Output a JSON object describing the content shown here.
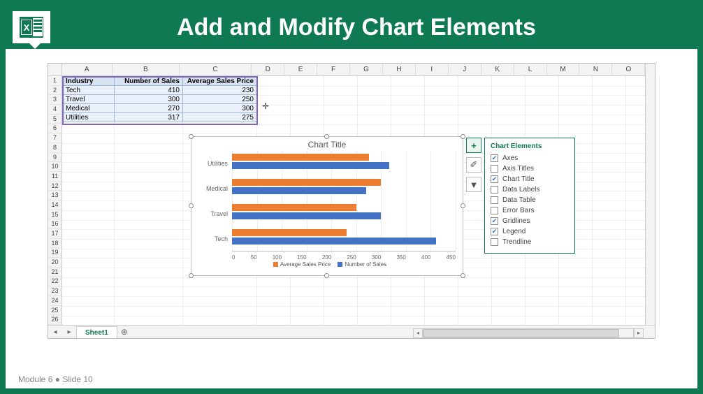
{
  "header": {
    "title": "Add and Modify Chart Elements",
    "app_icon_letter": "X"
  },
  "footer": {
    "module": "Module 6",
    "bullet": "●",
    "slide": "Slide 10"
  },
  "columns": [
    "A",
    "B",
    "C",
    "D",
    "E",
    "F",
    "G",
    "H",
    "I",
    "J",
    "K",
    "L",
    "M",
    "N",
    "O"
  ],
  "row_count": 26,
  "table": {
    "headers": [
      "Industry",
      "Number of Sales",
      "Average Sales Price"
    ],
    "rows": [
      {
        "industry": "Tech",
        "sales": "410",
        "price": "230"
      },
      {
        "industry": "Travel",
        "sales": "300",
        "price": "250"
      },
      {
        "industry": "Medical",
        "sales": "270",
        "price": "300"
      },
      {
        "industry": "Utilities",
        "sales": "317",
        "price": "275"
      }
    ]
  },
  "chart_data": {
    "type": "bar",
    "title": "Chart Title",
    "categories": [
      "Utilities",
      "Medical",
      "Travel",
      "Tech"
    ],
    "series": [
      {
        "name": "Average Sales Price",
        "color": "#ed7d31",
        "values": [
          275,
          300,
          250,
          230
        ]
      },
      {
        "name": "Number of Sales",
        "color": "#4472c4",
        "values": [
          317,
          270,
          300,
          410
        ]
      }
    ],
    "xlim": [
      0,
      450
    ],
    "xticks": [
      0,
      50,
      100,
      150,
      200,
      250,
      300,
      350,
      400,
      450
    ],
    "xlabel": "",
    "ylabel": ""
  },
  "chart_elements_panel": {
    "title": "Chart Elements",
    "items": [
      {
        "label": "Axes",
        "checked": true
      },
      {
        "label": "Axis Titles",
        "checked": false
      },
      {
        "label": "Chart Title",
        "checked": true
      },
      {
        "label": "Data Labels",
        "checked": false
      },
      {
        "label": "Data Table",
        "checked": false
      },
      {
        "label": "Error Bars",
        "checked": false
      },
      {
        "label": "Gridlines",
        "checked": true
      },
      {
        "label": "Legend",
        "checked": true
      },
      {
        "label": "Trendline",
        "checked": false
      }
    ]
  },
  "side_buttons": {
    "plus": "+",
    "brush": "✐",
    "filter": "▾"
  },
  "sheet_tab": {
    "name": "Sheet1",
    "add": "⊕"
  }
}
